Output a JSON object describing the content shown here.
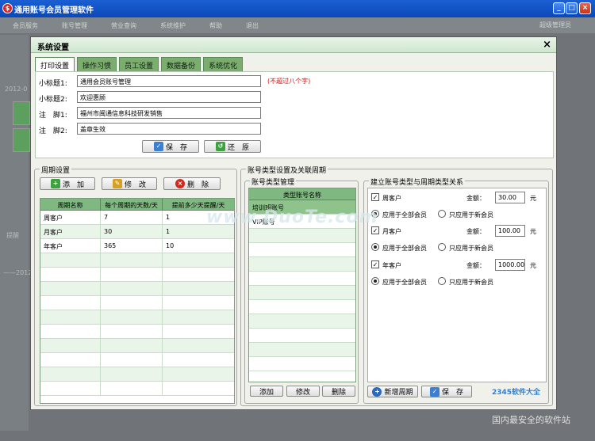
{
  "app": {
    "title": "通用账号会员管理软件",
    "menu": [
      "会员服务",
      "账号管理",
      "营业查询",
      "系统维护",
      "帮助",
      "退出"
    ],
    "top_right": "超级管理员",
    "dim_labels": [
      "2012-0",
      "提醒",
      "——2012"
    ]
  },
  "dialog": {
    "title": "系统设置",
    "close": "×",
    "tabs": [
      "打印设置",
      "操作习惯",
      "员工设置",
      "数据备份",
      "系统优化"
    ],
    "print": {
      "fields": [
        {
          "label": "小标题1:",
          "value": "通用会员账号管理"
        },
        {
          "label": "小标题2:",
          "value": "欢迎惠顾"
        },
        {
          "label": "注　脚1:",
          "value": "福州市闽通信息科技研发销售"
        },
        {
          "label": "注　脚2:",
          "value": "盖章生效"
        }
      ],
      "hint": "(不超过八个字)",
      "save": "保　存",
      "restore": "还　原"
    },
    "period": {
      "title": "周期设置",
      "add": "添　加",
      "edit": "修　改",
      "delete": "删　除",
      "columns": [
        "周期名称",
        "每个周期的天数/天",
        "提前多少天提醒/天"
      ],
      "rows": [
        [
          "周客户",
          "7",
          "1"
        ],
        [
          "月客户",
          "30",
          "1"
        ],
        [
          "年客户",
          "365",
          "10"
        ]
      ]
    },
    "account": {
      "title": "账号类型设置及关联周期",
      "type_mgmt": "账号类型管理",
      "column": "类型账号名称",
      "rows": [
        "培训班账号",
        "VIP账号"
      ],
      "add": "添加",
      "edit": "修改",
      "delete": "删除",
      "relation_title": "建立账号类型与周期类型关系",
      "amount_label": "金额：",
      "unit": "元",
      "opt_all": "应用于全部会员",
      "opt_new": "只应用于新会员",
      "relations": [
        {
          "name": "周客户",
          "amount": "30.00"
        },
        {
          "name": "月客户",
          "amount": "100.00"
        },
        {
          "name": "年客户",
          "amount": "1000.00"
        }
      ],
      "new_period": "新增周期",
      "save": "保　存"
    }
  },
  "watermark": "www.DuoTe.com",
  "corner_logo": "2345软件大全",
  "corner_slogan": "国内最安全的软件站"
}
